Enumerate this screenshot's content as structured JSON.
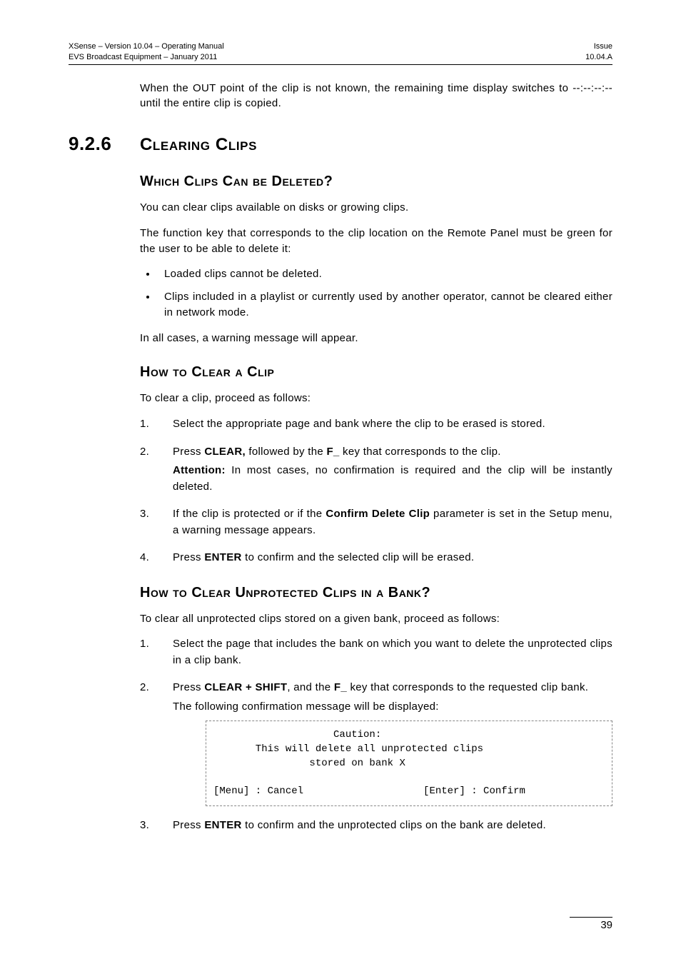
{
  "header": {
    "left_line1": "XSense – Version 10.04 – Operating Manual",
    "left_line2": "EVS Broadcast Equipment  – January 2011",
    "right_line1": "Issue",
    "right_line2": "10.04.A"
  },
  "intro_para": "When the OUT point of the clip is not known, the remaining time display switches to --:--:--:-- until the entire clip is copied.",
  "section": {
    "number": "9.2.6",
    "title": "Clearing Clips"
  },
  "sub1": {
    "heading": "Which Clips Can be Deleted?",
    "p1": "You can clear clips available on disks or growing clips.",
    "p2": "The function key that corresponds to the clip location on the Remote Panel must be green for the user to be able to delete it:",
    "bullets": [
      "Loaded clips cannot be deleted.",
      "Clips included in a playlist or currently used by another operator, cannot be cleared either in network mode."
    ],
    "p3": "In all cases, a warning message will appear."
  },
  "sub2": {
    "heading": "How to Clear a Clip",
    "intro": "To clear a clip, proceed as follows:",
    "steps": {
      "s1": "Select the appropriate page and bank where the clip to be erased is stored.",
      "s2_pre": "Press ",
      "s2_b1": "CLEAR,",
      "s2_mid": " followed by the ",
      "s2_b2": "F_",
      "s2_post": " key that corresponds to the clip.",
      "s2_att_label": "Attention:",
      "s2_att_text": " In most cases, no confirmation is required and the clip will be instantly deleted.",
      "s3_pre": "If the clip is protected or if the ",
      "s3_b1": "Confirm Delete Clip",
      "s3_post": " parameter is set in the Setup menu, a warning message appears.",
      "s4_pre": "Press ",
      "s4_b1": "ENTER",
      "s4_post": " to confirm and the selected clip will be erased."
    }
  },
  "sub3": {
    "heading": "How to Clear Unprotected Clips in a Bank?",
    "intro": "To clear all unprotected clips stored on a given bank, proceed as follows:",
    "steps": {
      "s1": "Select the page that includes the bank on which you want to delete the unprotected clips in a clip bank.",
      "s2_pre": "Press ",
      "s2_b1": "CLEAR + SHIFT",
      "s2_mid": ", and the ",
      "s2_b2": "F_",
      "s2_post": " key that corresponds to the requested clip bank.",
      "s2_cont": "The following confirmation message will be displayed:",
      "s3_pre": "Press ",
      "s3_b1": "ENTER",
      "s3_post": " to confirm and the unprotected clips on the bank are deleted."
    },
    "caution_text": "                    Caution:\n       This will delete all unprotected clips\n                stored on bank X\n\n[Menu] : Cancel                    [Enter] : Confirm"
  },
  "page_number": "39"
}
